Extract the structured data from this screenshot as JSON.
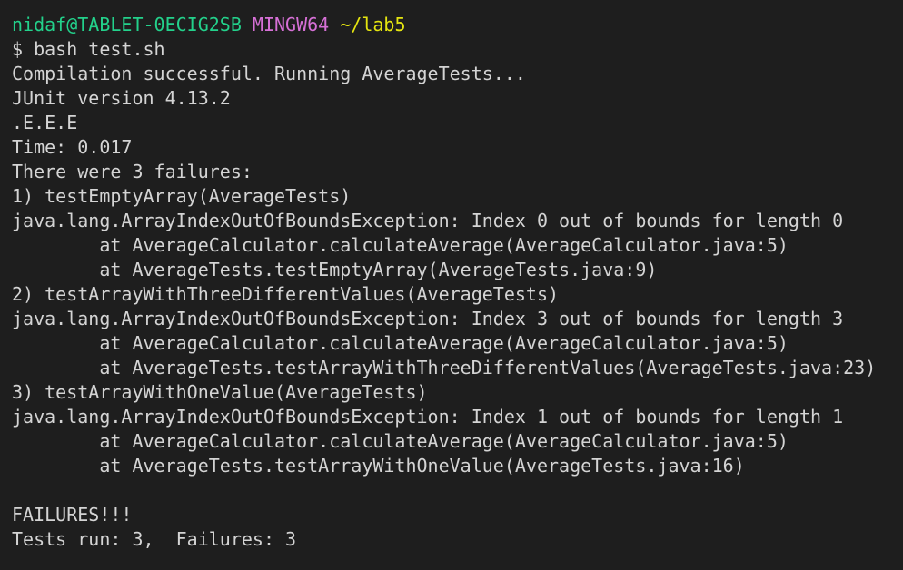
{
  "prompt": {
    "user_host": "nidaf@TABLET-0ECIG2SB",
    "system": "MINGW64",
    "path": "~/lab5"
  },
  "lines": [
    "$ bash test.sh",
    "Compilation successful. Running AverageTests...",
    "JUnit version 4.13.2",
    ".E.E.E",
    "Time: 0.017",
    "There were 3 failures:",
    "1) testEmptyArray(AverageTests)",
    "java.lang.ArrayIndexOutOfBoundsException: Index 0 out of bounds for length 0",
    "        at AverageCalculator.calculateAverage(AverageCalculator.java:5)",
    "        at AverageTests.testEmptyArray(AverageTests.java:9)",
    "2) testArrayWithThreeDifferentValues(AverageTests)",
    "java.lang.ArrayIndexOutOfBoundsException: Index 3 out of bounds for length 3",
    "        at AverageCalculator.calculateAverage(AverageCalculator.java:5)",
    "        at AverageTests.testArrayWithThreeDifferentValues(AverageTests.java:23)",
    "3) testArrayWithOneValue(AverageTests)",
    "java.lang.ArrayIndexOutOfBoundsException: Index 1 out of bounds for length 1",
    "        at AverageCalculator.calculateAverage(AverageCalculator.java:5)",
    "        at AverageTests.testArrayWithOneValue(AverageTests.java:16)",
    "",
    "FAILURES!!!",
    "Tests run: 3,  Failures: 3"
  ],
  "colors": {
    "background": "#1e1e1e",
    "text": "#d4d4d4",
    "user_host": "#23d18b",
    "system": "#d670d6",
    "path": "#e5e510"
  }
}
